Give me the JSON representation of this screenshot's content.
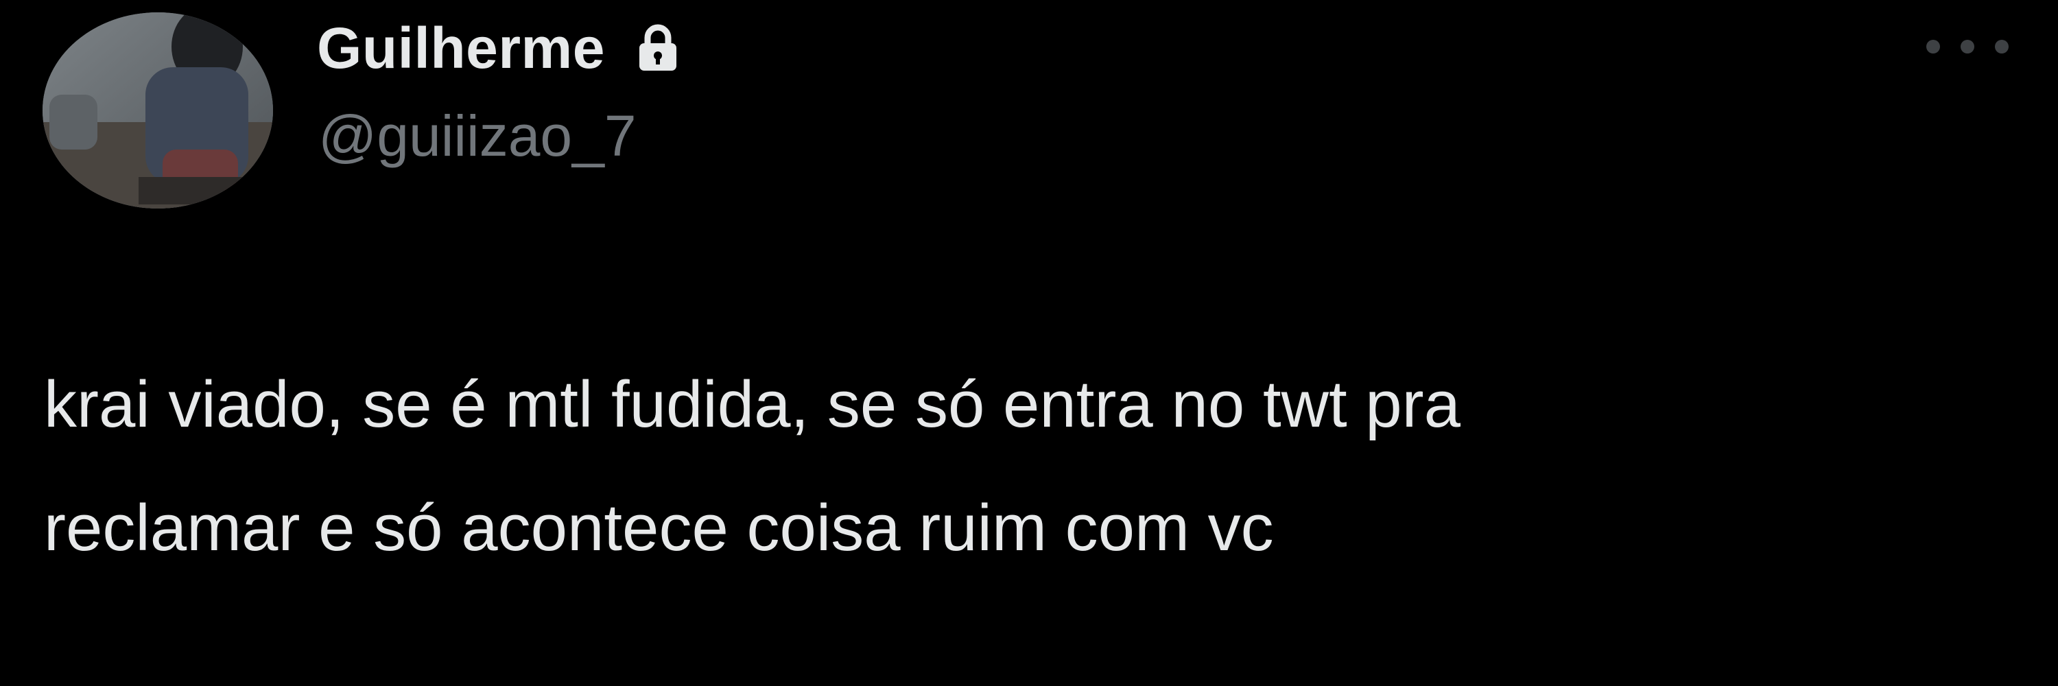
{
  "tweet": {
    "author": {
      "display_name": "Guilherme",
      "handle": "@guiiizao_7",
      "protected_icon": "lock-icon",
      "avatar_icon": "avatar-photo"
    },
    "menu_icon": "more-horizontal-icon",
    "text_lines": [
      "krai viado, se é mtl fudida, se só entra no twt pra",
      "reclamar e só acontece coisa ruim com vc"
    ]
  },
  "colors": {
    "background": "#000000",
    "primary_text": "#e7e9ea",
    "secondary_text": "#71767b"
  }
}
